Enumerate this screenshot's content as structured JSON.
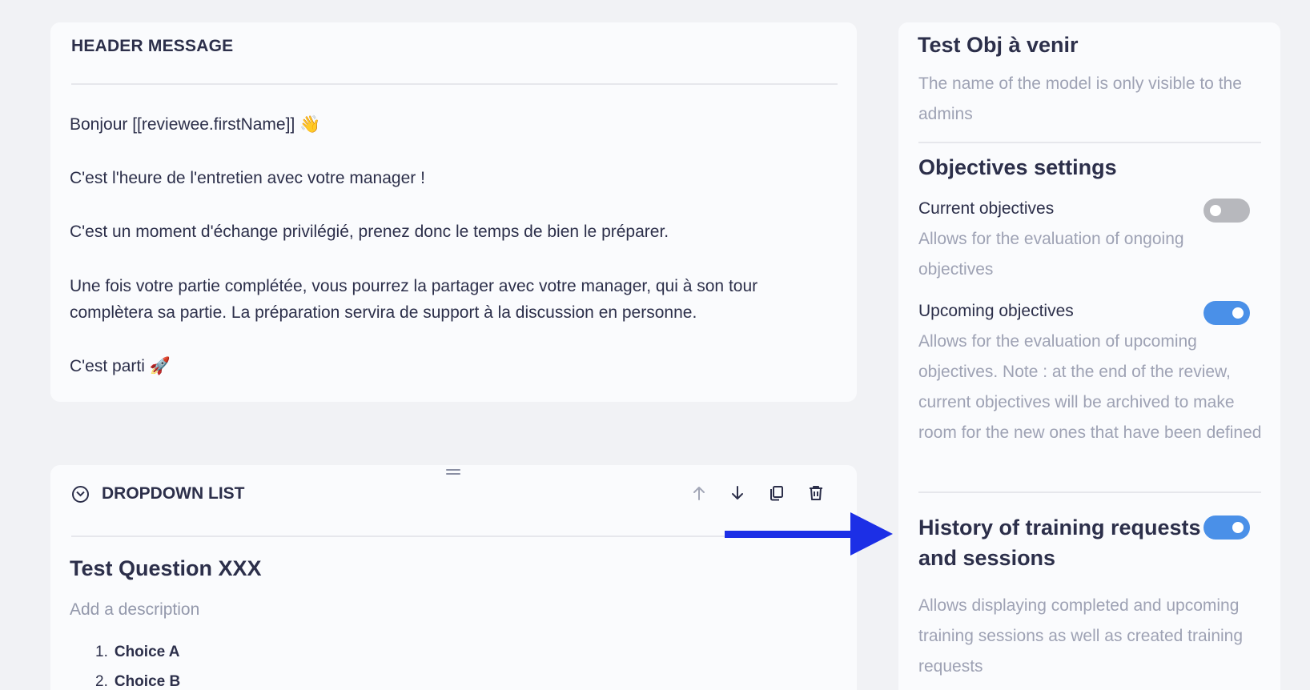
{
  "header_message": {
    "title": "HEADER MESSAGE",
    "paragraphs": [
      "Bonjour [[reviewee.firstName]] 👋",
      "C'est l'heure de l'entretien avec votre manager !",
      "C'est un moment d'échange privilégié, prenez donc le temps de bien le préparer.",
      "Une fois votre partie complétée, vous pourrez la partager avec votre manager, qui à son tour complètera sa partie. La préparation servira de support à la discussion en personne.",
      "C'est parti 🚀"
    ]
  },
  "dropdown_block": {
    "title": "DROPDOWN LIST",
    "question": "Test Question XXX",
    "description_placeholder": "Add a description",
    "choices": [
      {
        "num": "1.",
        "label": "Choice A"
      },
      {
        "num": "2.",
        "label": "Choice B"
      }
    ],
    "tools": [
      "arrow-up-icon",
      "arrow-down-icon",
      "duplicate-icon",
      "trash-icon"
    ]
  },
  "side_panel": {
    "model_name": "Test Obj à venir",
    "model_note": "The name of the model is only visible to the admins",
    "section_title": "Objectives settings",
    "current": {
      "label": "Current objectives",
      "enabled": false,
      "description": "Allows for the evaluation of ongoing objectives"
    },
    "upcoming": {
      "label": "Upcoming objectives",
      "enabled": true,
      "description": "Allows for the evaluation of upcoming objectives. Note : at the end of the review, current objectives will be archived to make room for the new ones that have been defined"
    },
    "training": {
      "label": "History of training requests and sessions",
      "enabled": true,
      "description": "Allows displaying completed and upcoming training sessions as well as created training requests"
    }
  },
  "colors": {
    "toggle_on": "#4a90e8",
    "toggle_off": "#b7b8bd",
    "annotation_arrow": "#1c2fe6"
  }
}
